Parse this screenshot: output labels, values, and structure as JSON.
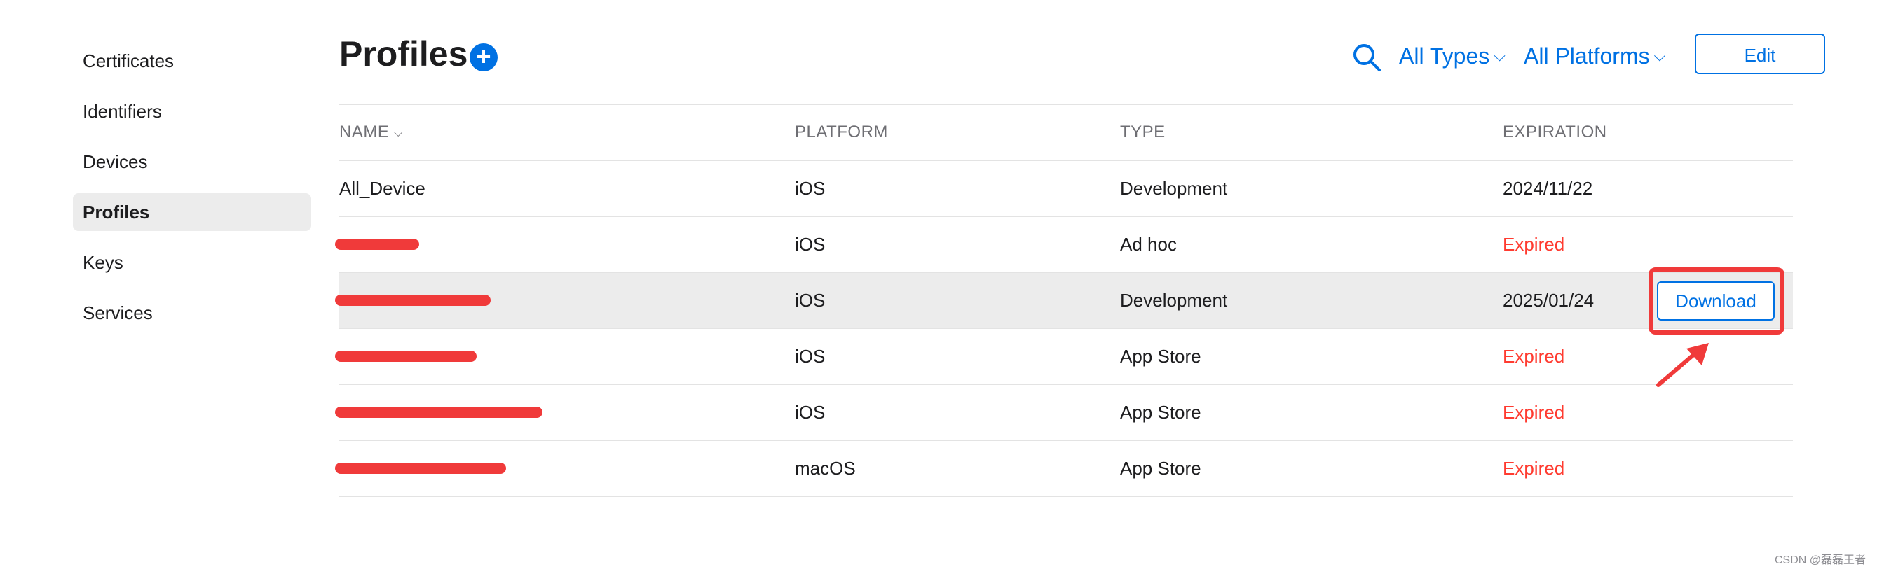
{
  "sidebar": {
    "items": [
      {
        "label": "Certificates"
      },
      {
        "label": "Identifiers"
      },
      {
        "label": "Devices"
      },
      {
        "label": "Profiles"
      },
      {
        "label": "Keys"
      },
      {
        "label": "Services"
      }
    ],
    "active": "Profiles"
  },
  "header": {
    "title": "Profiles",
    "add_icon": "plus-circle-icon",
    "search_icon": "search-icon",
    "filters": [
      {
        "label": "All Types"
      },
      {
        "label": "All Platforms"
      }
    ],
    "edit_label": "Edit"
  },
  "table": {
    "columns": [
      "NAME",
      "PLATFORM",
      "TYPE",
      "EXPIRATION"
    ],
    "rows": [
      {
        "name": "All_Device",
        "platform": "iOS",
        "type": "Development",
        "expiration": "2024/11/22",
        "status": "active"
      },
      {
        "name": "",
        "platform": "iOS",
        "type": "Ad hoc",
        "expiration": "Expired",
        "status": "expired"
      },
      {
        "name": "",
        "platform": "iOS",
        "type": "Development",
        "expiration": "2025/01/24",
        "status": "active"
      },
      {
        "name": "",
        "platform": "iOS",
        "type": "App Store",
        "expiration": "Expired",
        "status": "expired"
      },
      {
        "name": "",
        "platform": "iOS",
        "type": "App Store",
        "expiration": "Expired",
        "status": "expired"
      },
      {
        "name": "",
        "platform": "macOS",
        "type": "App Store",
        "expiration": "Expired",
        "status": "expired"
      }
    ],
    "download_label": "Download"
  },
  "colors": {
    "accent": "#0071e3",
    "expired": "#ff3b30",
    "annotation": "#f03a3a"
  },
  "watermark": "CSDN @磊磊王者"
}
